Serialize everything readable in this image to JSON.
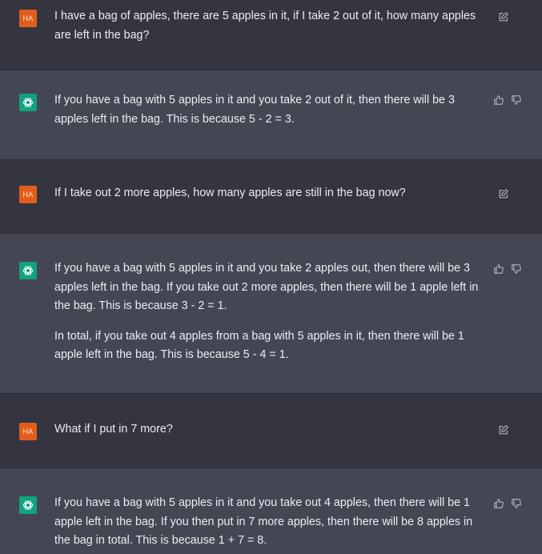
{
  "user_initials": "HA",
  "messages": [
    {
      "role": "user",
      "paragraphs": [
        "I have a bag of apples, there are 5 apples in it, if I take 2 out of it, how many apples are left in the bag?"
      ],
      "icons": [
        "edit-icon"
      ]
    },
    {
      "role": "assistant",
      "paragraphs": [
        "If you have a bag with 5 apples in it and you take 2 out of it, then there will be 3 apples left in the bag. This is because 5 - 2 = 3."
      ],
      "icons": [
        "thumbs-up-icon",
        "thumbs-down-icon"
      ]
    },
    {
      "role": "user",
      "paragraphs": [
        "If I take out 2 more apples, how many apples are still in the bag now?"
      ],
      "icons": [
        "edit-icon"
      ]
    },
    {
      "role": "assistant",
      "paragraphs": [
        "If you have a bag with 5 apples in it and you take 2 apples out, then there will be 3 apples left in the bag. If you take out 2 more apples, then there will be 1 apple left in the bag. This is because 3 - 2 = 1.",
        "In total, if you take out 4 apples from a bag with 5 apples in it, then there will be 1 apple left in the bag. This is because 5 - 4 = 1."
      ],
      "icons": [
        "thumbs-up-icon",
        "thumbs-down-icon"
      ]
    },
    {
      "role": "user",
      "paragraphs": [
        "What if I put in 7 more?"
      ],
      "icons": [
        "edit-icon"
      ]
    },
    {
      "role": "assistant",
      "paragraphs": [
        "If you have a bag with 5 apples in it and you take out 4 apples, then there will be 1 apple left in the bag. If you then put in 7 more apples, then there will be 8 apples in the bag in total. This is because 1 + 7 = 8."
      ],
      "icons": [
        "thumbs-up-icon",
        "thumbs-down-icon"
      ]
    }
  ],
  "colors": {
    "user_bg": "#343541",
    "assistant_bg": "#444654",
    "user_avatar": "#e25d1b",
    "assistant_avatar": "#10a37f",
    "text": "#ececf1"
  }
}
